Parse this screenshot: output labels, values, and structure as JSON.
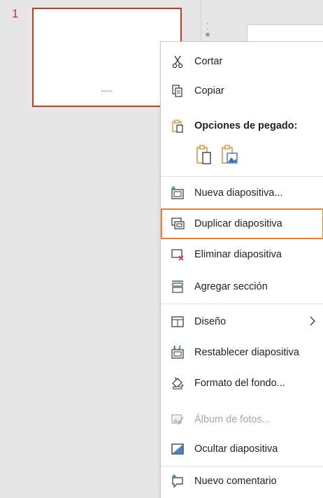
{
  "thumbnails": {
    "slide_number": "1",
    "slide_caption": "Rosenrosée"
  },
  "ruler": {
    "marks": "-\n-\n⊕"
  },
  "menu": {
    "cut": "Cortar",
    "copy": "Copiar",
    "paste_options": "Opciones de pegado:",
    "new_slide": "Nueva diapositiva...",
    "duplicate_slide": "Duplicar diapositiva",
    "delete_slide": "Eliminar diapositiva",
    "add_section": "Agregar sección",
    "layout": "Diseño",
    "reset_slide": "Restablecer diapositiva",
    "format_background": "Formato del fondo...",
    "photo_album": "Álbum de fotos...",
    "hide_slide": "Ocultar diapositiva",
    "new_comment": "Nuevo comentario"
  },
  "colors": {
    "accent": "#c43e1c",
    "highlight": "#ed7d31",
    "icon_orange": "#d8892b",
    "icon_blue": "#2f6fb3",
    "icon_green": "#3a9a4a",
    "icon_red": "#d13438"
  },
  "icons": [
    "scissors-icon",
    "copy-icon",
    "clipboard-icon",
    "paste-keep-icon",
    "paste-picture-icon",
    "new-slide-icon",
    "duplicate-slide-icon",
    "delete-slide-icon",
    "add-section-icon",
    "layout-icon",
    "reset-slide-icon",
    "format-background-icon",
    "photo-album-icon",
    "hide-slide-icon",
    "new-comment-icon",
    "chevron-right-icon"
  ]
}
